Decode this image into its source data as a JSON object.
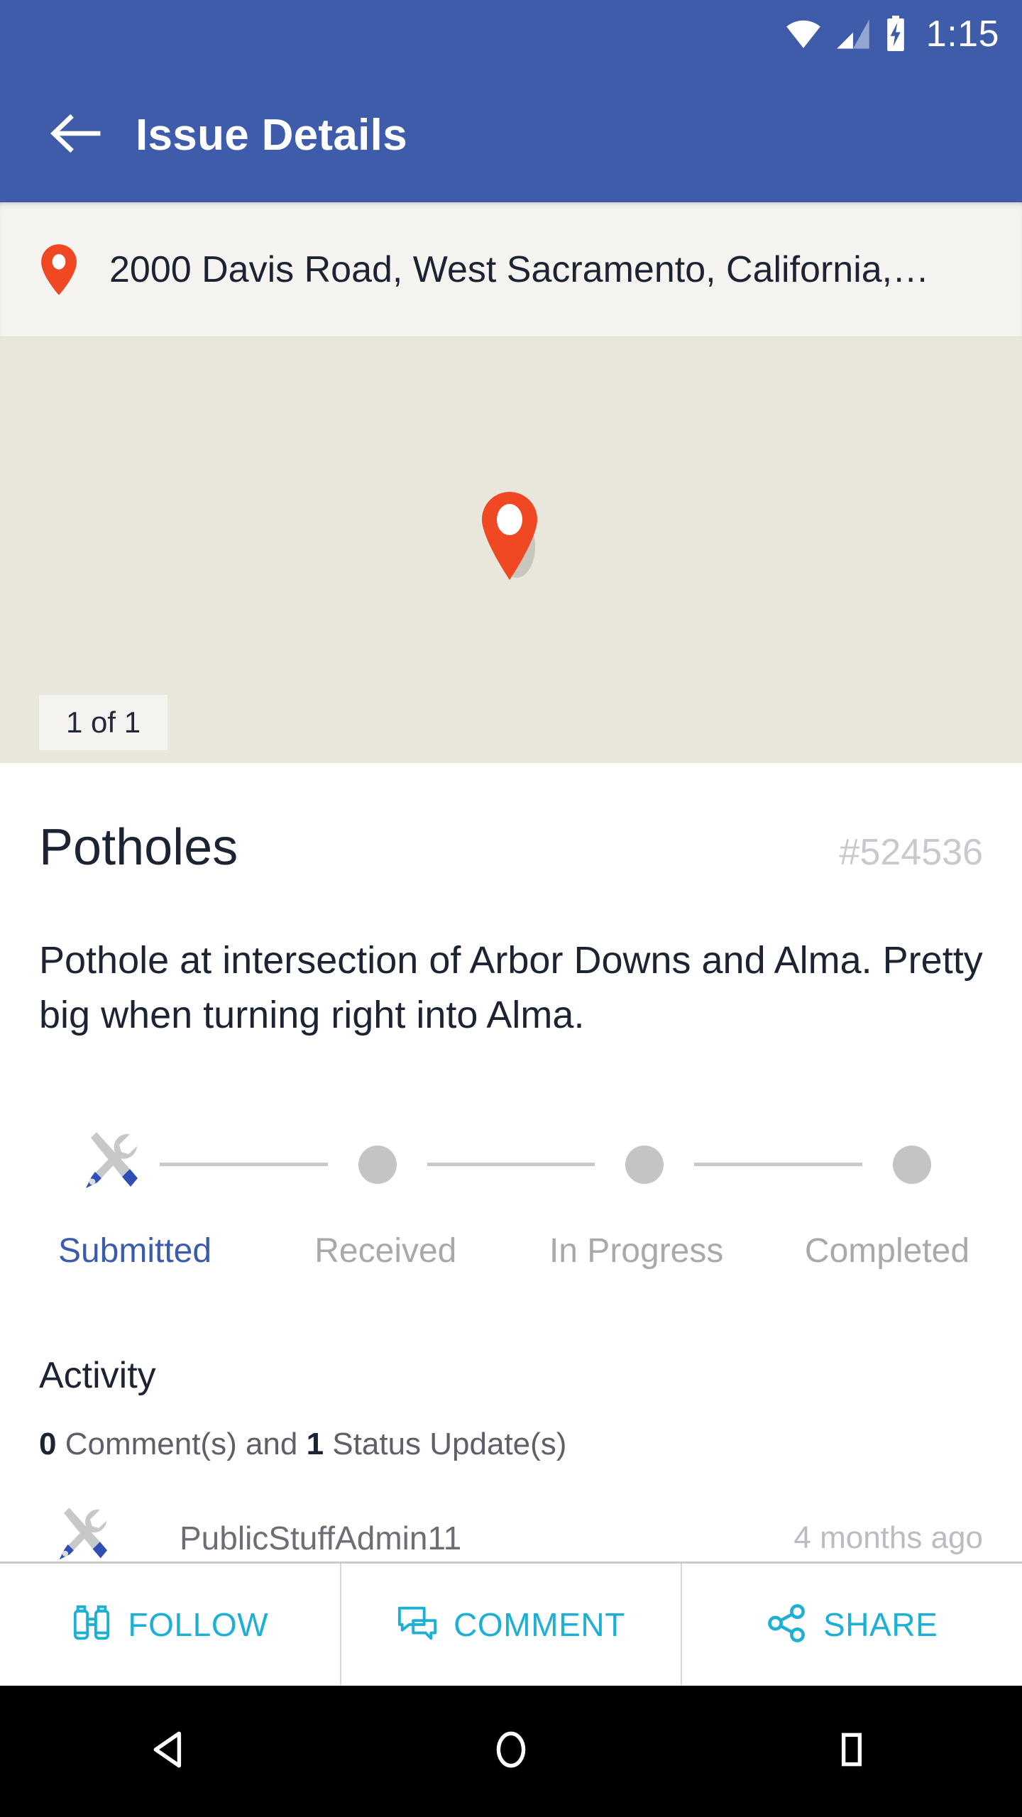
{
  "status_bar": {
    "time": "1:15",
    "icons": [
      "wifi-icon",
      "cellular-signal-icon",
      "battery-charging-icon"
    ]
  },
  "app_bar": {
    "back_icon": "back-arrow-icon",
    "title": "Issue Details"
  },
  "address_bar": {
    "pin_icon": "map-pin-icon",
    "address": "2000  Davis Road, West Sacramento, California,…"
  },
  "map": {
    "marker_icon": "map-marker-icon",
    "page_badge": "1 of 1"
  },
  "issue": {
    "title": "Potholes",
    "number": "#524536",
    "description": "Pothole at intersection of Arbor Downs and Alma. Pretty big when turning right into Alma."
  },
  "stepper": {
    "steps": [
      {
        "label": "Submitted",
        "state": "active",
        "icon": "tools-icon"
      },
      {
        "label": "Received",
        "state": "pending",
        "icon": "dot-icon"
      },
      {
        "label": "In Progress",
        "state": "pending",
        "icon": "dot-icon"
      },
      {
        "label": "Completed",
        "state": "pending",
        "icon": "dot-icon"
      }
    ]
  },
  "activity": {
    "heading": "Activity",
    "summary_comments_count": "0",
    "summary_middle": " Comment(s) and ",
    "summary_updates_count": "1",
    "summary_tail": " Status Update(s)",
    "entries": [
      {
        "avatar_icon": "tools-icon",
        "user": "PublicStuffAdmin11",
        "time": "4 months ago"
      }
    ]
  },
  "action_bar": {
    "buttons": [
      {
        "label": "FOLLOW",
        "icon": "binoculars-icon"
      },
      {
        "label": "COMMENT",
        "icon": "comment-bubbles-icon"
      },
      {
        "label": "SHARE",
        "icon": "share-nodes-icon"
      }
    ]
  },
  "nav_bar": {
    "buttons": [
      {
        "name": "back-triangle-icon"
      },
      {
        "name": "home-circle-icon"
      },
      {
        "name": "recents-square-icon"
      }
    ]
  },
  "colors": {
    "primary_blue": "#3f5cab",
    "accent_cyan": "#1eb0d4",
    "marker_orange": "#ef4823",
    "map_bg": "#e9e7dc",
    "text_dark": "#1c2333",
    "text_muted": "#a9a9ac"
  }
}
